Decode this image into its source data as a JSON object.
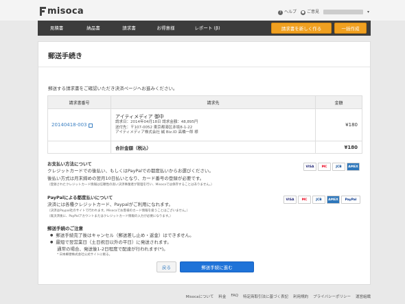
{
  "header": {
    "logo_text": "misoca",
    "help_label": "ヘルプ",
    "feedback_label": "ご意見",
    "caret": "▾"
  },
  "nav": {
    "items": [
      "見積書",
      "納品書",
      "請求書",
      "お得意様",
      "レポート (β)"
    ],
    "new_invoice_button": "請求書を新しく作る",
    "bulk_create_button": "一括作成"
  },
  "page": {
    "title": "郵送手続き",
    "intro": "郵送する請求書をご確認いただき決済ページへお進みください。"
  },
  "table": {
    "headers": [
      "請求書番号",
      "請求先",
      "金額"
    ],
    "rows": [
      {
        "invoice_no": "20140418-003",
        "recipient": "アイティメディア 御中",
        "address_lines": [
          "請求日：2014年04月18日  請求金額：48,895円",
          "送付先：〒107-0052 東京都港区赤坂8-1-22",
          "アイティメディア株式会社 誠 Biz.ID 高橋一郎 様"
        ],
        "amount": "¥180"
      }
    ],
    "total_label": "合計金額（税込）",
    "total_amount": "¥180"
  },
  "payment_method": {
    "title": "お支払い方法について",
    "line1": "クレジットカードでの後払い、もしくはPayPalでの都度払いからお選びください。",
    "line2": "後払い方式は月末締めの翌月10日払いとなり、カード番号の登録が必要です。",
    "note": "（登録されたクレジットカード情報は信頼性の高い決済事業者が管理を行い、Misocaでは保存することはありません。）",
    "cards": [
      "VISA",
      "MC",
      "JCB",
      "AMEX"
    ]
  },
  "paypal": {
    "title": "PayPalによる都度払いについて",
    "line1": "決済には各種クレジットカード、Paypalがご利用になれます。",
    "note1": "（決済はPaypal社のサイトで行われます。Misocaでお客様のカード情報を扱うことはございません。）",
    "note2": "（既決済後に、PayPalアカウントまたはクレジットカード情報の入力が必要になります。）",
    "cards": [
      "VISA",
      "MC",
      "JCB",
      "AMEX",
      "PayPal"
    ]
  },
  "notes": {
    "title": "郵送手続のご注意",
    "bullet1": "郵送手続完了後はキャンセル（郵送差し止め・返金）はできません。",
    "bullet2": "最短で翌営業日（土日祝日以外の平日）に発送されます。",
    "bullet2_sub": "通常の場合、発送後1-2日程度で配達が行われます(*)。",
    "footnote": "* 日本郵便株式会社公式サイトに拠る。"
  },
  "actions": {
    "back": "戻る",
    "proceed": "郵送手続に進む"
  },
  "footer": {
    "links": [
      "Misocaについて",
      "料金",
      "FAQ",
      "特定商取引法に基づく表記",
      "利用規約",
      "プライバシーポリシー",
      "運営組織"
    ]
  },
  "colors": {
    "accent_orange": "#f0a020",
    "primary_blue": "#1f73d8",
    "nav_bg": "#3c3c3c",
    "link": "#3a7fc2"
  }
}
